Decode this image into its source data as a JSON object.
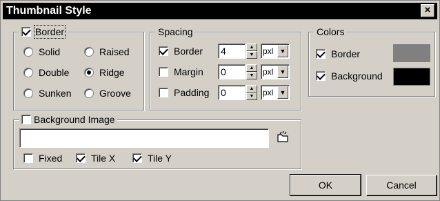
{
  "window": {
    "title": "Thumbnail Style",
    "close_glyph": "×"
  },
  "border_group": {
    "label": "Border",
    "checked": true,
    "options": [
      {
        "label": "Solid",
        "selected": false
      },
      {
        "label": "Raised",
        "selected": false
      },
      {
        "label": "Double",
        "selected": false
      },
      {
        "label": "Ridge",
        "selected": true
      },
      {
        "label": "Sunken",
        "selected": false
      },
      {
        "label": "Groove",
        "selected": false
      }
    ]
  },
  "spacing_group": {
    "label": "Spacing",
    "rows": [
      {
        "label": "Border",
        "checked": true,
        "value": "4",
        "unit": "pxl"
      },
      {
        "label": "Margin",
        "checked": false,
        "value": "0",
        "unit": "pxl"
      },
      {
        "label": "Padding",
        "checked": false,
        "value": "0",
        "unit": "pxl"
      }
    ]
  },
  "colors_group": {
    "label": "Colors",
    "rows": [
      {
        "label": "Border",
        "checked": true,
        "color": "#808080"
      },
      {
        "label": "Background",
        "checked": true,
        "color": "#000000"
      }
    ]
  },
  "background_image_group": {
    "label": "Background Image",
    "checked": false,
    "path_value": "",
    "browse_icon": "folder-icon",
    "options": [
      {
        "label": "Fixed",
        "checked": false
      },
      {
        "label": "Tile X",
        "checked": true
      },
      {
        "label": "Tile Y",
        "checked": true
      }
    ]
  },
  "buttons": {
    "ok": "OK",
    "cancel": "Cancel"
  }
}
